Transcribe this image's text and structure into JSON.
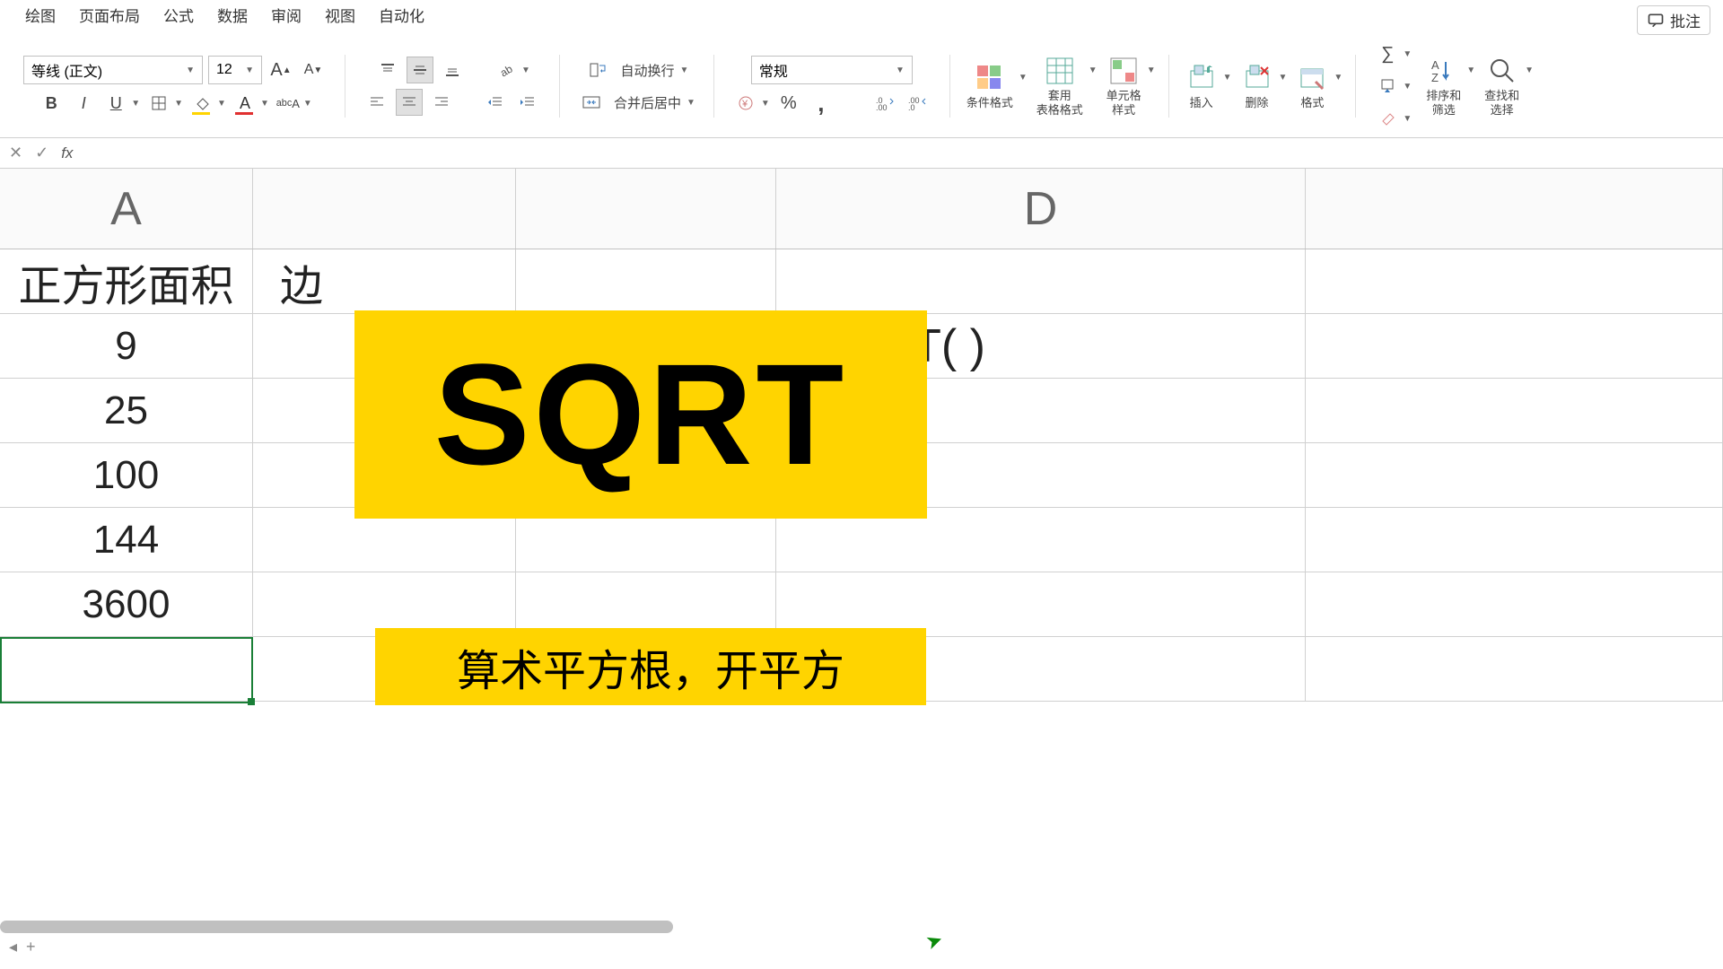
{
  "menu": {
    "items": [
      "绘图",
      "页面布局",
      "公式",
      "数据",
      "审阅",
      "视图",
      "自动化"
    ]
  },
  "comment_btn": "批注",
  "ribbon": {
    "font_name": "等线 (正文)",
    "font_size": "12",
    "wrap_text": "自动换行",
    "merge_center": "合并后居中",
    "number_format": "常规",
    "cond_format": "条件格式",
    "table_format": "套用\n表格格式",
    "cell_styles": "单元格\n样式",
    "insert": "插入",
    "delete": "删除",
    "format": "格式",
    "sort_filter": "排序和\n筛选",
    "find_select": "查找和\n选择"
  },
  "columns": {
    "A": "A",
    "D": "D"
  },
  "cells": {
    "A1": "正方形面积",
    "B1": "边",
    "A2": "9",
    "A3": "25",
    "A4": "100",
    "A5": "144",
    "A6": "3600",
    "D2": "=SQRT(      )"
  },
  "overlays": {
    "sqrt": "SQRT",
    "desc": "算术平方根，开平方"
  },
  "sheet_tabs": {
    "add": "+"
  }
}
